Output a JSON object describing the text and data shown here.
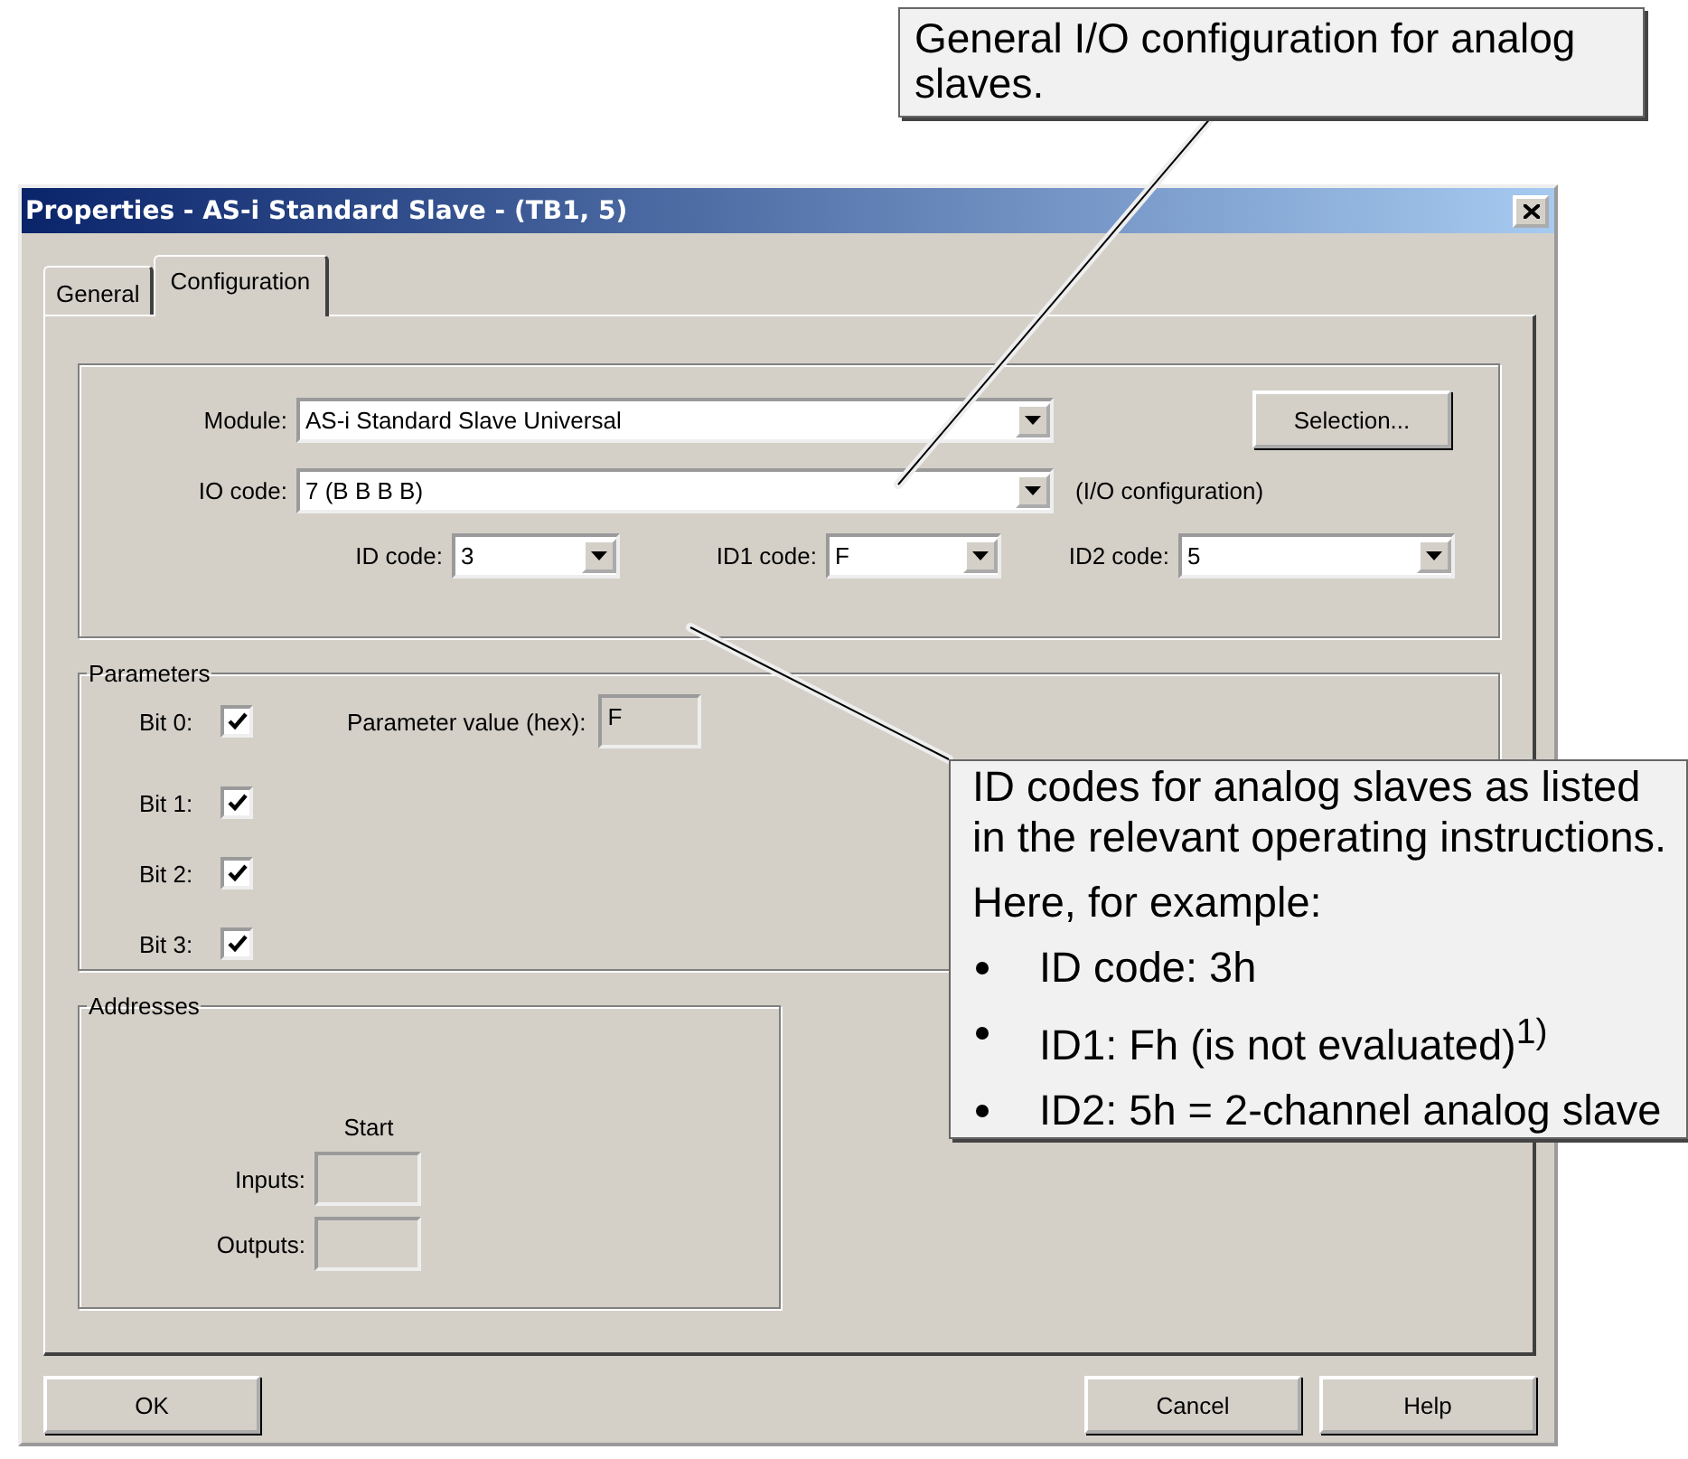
{
  "callouts": [
    {
      "paragraphs": [
        "General I/O configuration for analog slaves."
      ]
    },
    {
      "paragraphs": [
        "ID codes for analog slaves as listed in the relevant operating instructions.",
        "Here, for example:"
      ],
      "bullets": [
        "ID code: 3h",
        "ID1: Fh (is not evaluated)$^{1)}$",
        "ID2: 5h = 2-channel analog slave"
      ]
    }
  ],
  "window": {
    "title": "Properties - AS-i Standard Slave - (TB1, 5)"
  },
  "tabs": [
    {
      "label": "General",
      "selected": false
    },
    {
      "label": "Configuration",
      "selected": true
    }
  ],
  "module": {
    "label": "Module:",
    "value": "AS-i Standard Slave Universal",
    "button": "Selection..."
  },
  "io_code": {
    "label": "IO code:",
    "value": "7  (B B B B)",
    "note": "(I/O configuration)"
  },
  "id_codes": [
    {
      "label": "ID code:",
      "value": "3"
    },
    {
      "label": "ID1 code:",
      "value": "F"
    },
    {
      "label": "ID2 code:",
      "value": "5"
    }
  ],
  "parameters": {
    "title": "Parameters",
    "bits": [
      {
        "label": "Bit 0:",
        "checked": true
      },
      {
        "label": "Bit 1:",
        "checked": true
      },
      {
        "label": "Bit 2:",
        "checked": true
      },
      {
        "label": "Bit 3:",
        "checked": true
      }
    ],
    "value_label": "Parameter value (hex):",
    "value": "F"
  },
  "addresses": {
    "title": "Addresses",
    "column": "Start",
    "rows": [
      {
        "label": "Inputs:"
      },
      {
        "label": "Outputs:"
      }
    ]
  },
  "buttons": [
    "OK",
    "Cancel",
    "Help"
  ]
}
